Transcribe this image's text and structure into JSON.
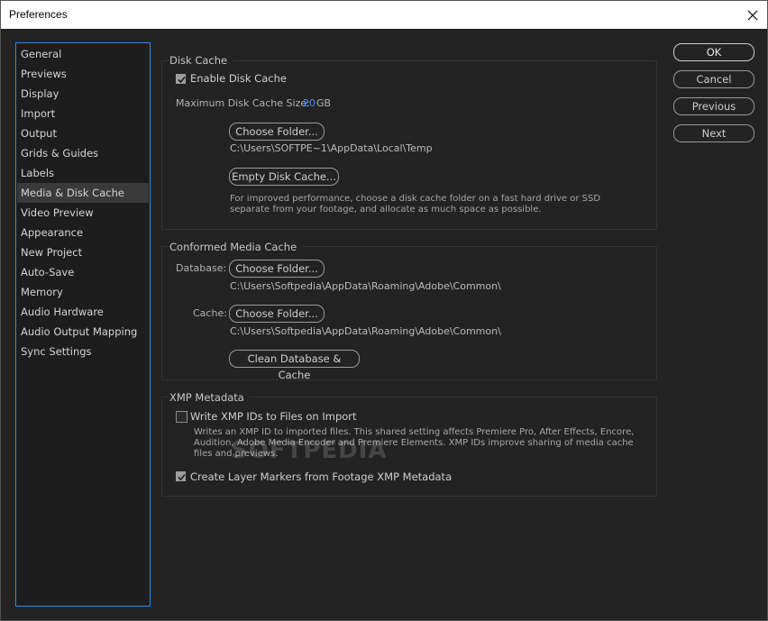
{
  "window": {
    "title": "Preferences"
  },
  "sidebar": {
    "items": [
      {
        "label": "General"
      },
      {
        "label": "Previews"
      },
      {
        "label": "Display"
      },
      {
        "label": "Import"
      },
      {
        "label": "Output"
      },
      {
        "label": "Grids & Guides"
      },
      {
        "label": "Labels"
      },
      {
        "label": "Media & Disk Cache",
        "active": true
      },
      {
        "label": "Video Preview"
      },
      {
        "label": "Appearance"
      },
      {
        "label": "New Project"
      },
      {
        "label": "Auto-Save"
      },
      {
        "label": "Memory"
      },
      {
        "label": "Audio Hardware"
      },
      {
        "label": "Audio Output Mapping"
      },
      {
        "label": "Sync Settings"
      }
    ]
  },
  "disk_cache": {
    "title": "Disk Cache",
    "enable_label": "Enable Disk Cache",
    "enable_checked": true,
    "max_size_label": "Maximum Disk Cache Size:",
    "max_size_value": "20",
    "max_size_unit": "GB",
    "choose_folder": "Choose Folder...",
    "folder_path": "C:\\Users\\SOFTPE~1\\AppData\\Local\\Temp",
    "empty_cache": "Empty Disk Cache...",
    "note": "For improved performance, choose a disk cache folder on a fast hard drive or SSD separate from your footage, and allocate as much space as possible."
  },
  "conformed_cache": {
    "title": "Conformed Media Cache",
    "database_label": "Database:",
    "database_button": "Choose Folder...",
    "database_path": "C:\\Users\\Softpedia\\AppData\\Roaming\\Adobe\\Common\\",
    "cache_label": "Cache:",
    "cache_button": "Choose Folder...",
    "cache_path": "C:\\Users\\Softpedia\\AppData\\Roaming\\Adobe\\Common\\",
    "clean_button": "Clean Database & Cache"
  },
  "xmp": {
    "title": "XMP Metadata",
    "write_ids_label": "Write XMP IDs to Files on Import",
    "write_ids_checked": false,
    "write_ids_note": "Writes an XMP ID to imported files. This shared setting affects Premiere Pro, After Effects, Encore, Audition, Adobe Media Encoder and Premiere Elements. XMP IDs improve sharing of media cache files and previews.",
    "layer_markers_label": "Create Layer Markers from Footage XMP Metadata",
    "layer_markers_checked": true
  },
  "actions": {
    "ok": "OK",
    "cancel": "Cancel",
    "previous": "Previous",
    "next": "Next"
  },
  "watermark": "SOFTPEDIA",
  "colors": {
    "background": "#232323",
    "sidebar_border": "#2d8ceb",
    "accent_value": "#3d93f5",
    "selected_item": "#3a3a3a"
  }
}
